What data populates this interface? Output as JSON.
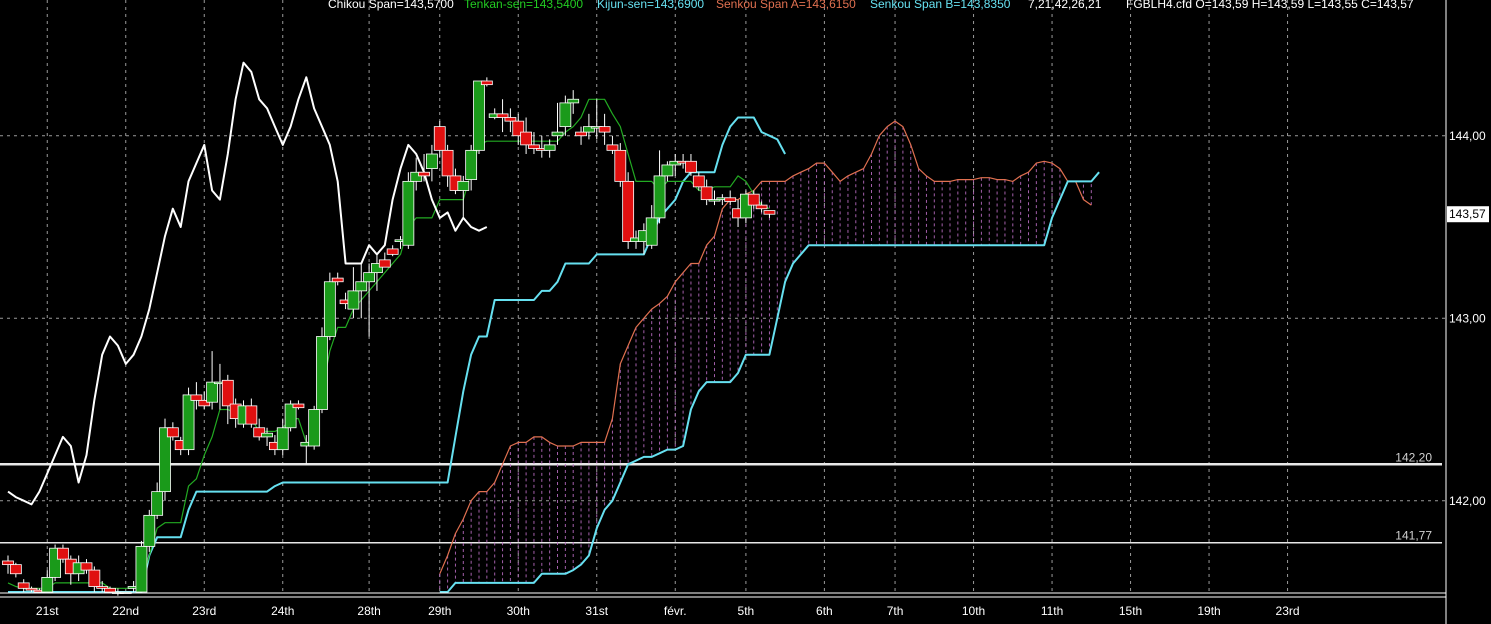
{
  "header": {
    "chikou": "Chikou Span=143,5700",
    "tenkan": "Tenkan-sen=143,5400",
    "kijun": "Kijun-sen=143,6900",
    "senkou_a": "Senkou Span A=143,6150",
    "senkou_b": "Senkou Span B=143,8350",
    "params": "7,21,42,26,21",
    "ohlc": "FGBLH4.cfd O=143,59 H=143,59 L=143,55 C=143,57"
  },
  "colors": {
    "background": "#000000",
    "bull": "#1a9a1a",
    "bear": "#e01010",
    "chikou": "#ffffff",
    "tenkan": "#22aa22",
    "kijun": "#66e0f0",
    "senkou_a": "#e07050",
    "senkou_b": "#66e0f0",
    "cloud_fill": "#c070c8",
    "grid": "#9a9a9a",
    "hline": "#e8e8e8"
  },
  "chart_data": {
    "type": "candlestick",
    "ylim": [
      141.5,
      144.7
    ],
    "y_ticks": [
      "144,00",
      "143,00",
      "142,00"
    ],
    "y_tick_values": [
      144.0,
      143.0,
      142.0
    ],
    "x_labels": [
      "21st",
      "22nd",
      "23rd",
      "24th",
      "28th",
      "29th",
      "30th",
      "31st",
      "févr.",
      "5th",
      "6th",
      "7th",
      "10th",
      "11th",
      "15th",
      "19th",
      "23rd"
    ],
    "x_label_index": [
      5,
      15,
      25,
      35,
      46,
      55,
      65,
      75,
      85,
      94,
      104,
      113,
      123,
      133,
      143,
      153,
      163
    ],
    "h_lines": [
      {
        "label": "142,20",
        "value": 142.2
      },
      {
        "label": "141,77",
        "value": 141.77
      }
    ],
    "last_price": "143,57",
    "last_price_value": 143.57,
    "candles": [
      [
        141.67,
        141.7,
        141.6,
        141.65
      ],
      [
        141.65,
        141.66,
        141.58,
        141.6
      ],
      [
        141.55,
        141.57,
        141.5,
        141.52
      ],
      [
        141.52,
        141.53,
        141.5,
        141.51
      ],
      [
        141.51,
        141.52,
        141.5,
        141.5
      ],
      [
        141.5,
        141.62,
        141.5,
        141.58
      ],
      [
        141.58,
        141.76,
        141.56,
        141.74
      ],
      [
        141.74,
        141.76,
        141.66,
        141.68
      ],
      [
        141.68,
        141.7,
        141.54,
        141.6
      ],
      [
        141.6,
        141.7,
        141.56,
        141.66
      ],
      [
        141.66,
        141.68,
        141.6,
        141.62
      ],
      [
        141.62,
        141.64,
        141.5,
        141.53
      ],
      [
        141.53,
        141.56,
        141.5,
        141.52
      ],
      [
        141.52,
        141.53,
        141.5,
        141.5
      ],
      [
        141.5,
        141.52,
        141.48,
        141.5
      ],
      [
        141.5,
        141.5,
        141.5,
        141.5
      ],
      [
        141.52,
        141.56,
        141.5,
        141.53
      ],
      [
        141.5,
        141.78,
        141.5,
        141.75
      ],
      [
        141.75,
        141.95,
        141.72,
        141.92
      ],
      [
        141.92,
        142.1,
        141.9,
        142.05
      ],
      [
        142.05,
        142.45,
        142.0,
        142.4
      ],
      [
        142.4,
        142.43,
        142.33,
        142.35
      ],
      [
        142.33,
        142.35,
        142.25,
        142.28
      ],
      [
        142.28,
        142.62,
        142.25,
        142.58
      ],
      [
        142.58,
        142.65,
        142.5,
        142.55
      ],
      [
        142.55,
        142.6,
        142.5,
        142.52
      ],
      [
        142.54,
        142.82,
        142.5,
        142.65
      ],
      [
        142.65,
        142.75,
        142.5,
        142.65
      ],
      [
        142.66,
        142.69,
        142.42,
        142.52
      ],
      [
        142.53,
        142.56,
        142.4,
        142.45
      ],
      [
        142.42,
        142.55,
        142.4,
        142.52
      ],
      [
        142.52,
        142.56,
        142.4,
        142.42
      ],
      [
        142.4,
        142.45,
        142.33,
        142.35
      ],
      [
        142.35,
        142.4,
        142.3,
        142.37
      ],
      [
        142.32,
        142.36,
        142.25,
        142.28
      ],
      [
        142.28,
        142.45,
        142.25,
        142.4
      ],
      [
        142.4,
        142.55,
        142.38,
        142.53
      ],
      [
        142.53,
        142.55,
        142.5,
        142.51
      ],
      [
        142.3,
        142.36,
        142.2,
        142.32
      ],
      [
        142.3,
        142.52,
        142.28,
        142.5
      ],
      [
        142.5,
        142.95,
        142.48,
        142.9
      ],
      [
        142.9,
        143.25,
        142.88,
        143.2
      ],
      [
        143.22,
        143.25,
        143.18,
        143.2
      ],
      [
        143.1,
        143.14,
        143.05,
        143.08
      ],
      [
        143.05,
        143.28,
        143.0,
        143.15
      ],
      [
        143.15,
        143.3,
        143.0,
        143.2
      ],
      [
        143.2,
        143.3,
        142.9,
        143.25
      ],
      [
        143.25,
        143.35,
        143.15,
        143.3
      ],
      [
        143.32,
        143.36,
        143.28,
        143.28
      ],
      [
        143.38,
        143.4,
        143.34,
        143.35
      ],
      [
        143.42,
        143.45,
        143.38,
        143.43
      ],
      [
        143.4,
        143.8,
        143.38,
        143.75
      ],
      [
        143.75,
        143.88,
        143.7,
        143.8
      ],
      [
        143.8,
        143.9,
        143.75,
        143.78
      ],
      [
        143.82,
        143.95,
        143.75,
        143.9
      ],
      [
        144.05,
        144.08,
        143.88,
        143.92
      ],
      [
        143.92,
        143.95,
        143.72,
        143.78
      ],
      [
        143.78,
        143.82,
        143.68,
        143.7
      ],
      [
        143.7,
        143.78,
        143.55,
        143.75
      ],
      [
        143.76,
        143.95,
        143.7,
        143.92
      ],
      [
        143.92,
        144.3,
        143.9,
        144.3
      ],
      [
        144.3,
        144.32,
        144.27,
        144.28
      ],
      [
        144.1,
        144.15,
        144.09,
        144.12
      ],
      [
        144.12,
        144.2,
        144.02,
        144.1
      ],
      [
        144.1,
        144.15,
        144.02,
        144.08
      ],
      [
        144.08,
        144.12,
        143.95,
        144.0
      ],
      [
        144.02,
        144.1,
        143.9,
        143.95
      ],
      [
        143.95,
        144.02,
        143.9,
        143.93
      ],
      [
        143.93,
        144.0,
        143.88,
        143.92
      ],
      [
        143.92,
        143.98,
        143.88,
        143.95
      ],
      [
        144.0,
        144.18,
        143.95,
        144.02
      ],
      [
        144.05,
        144.22,
        144.0,
        144.18
      ],
      [
        144.18,
        144.25,
        144.12,
        144.2
      ],
      [
        144.02,
        144.05,
        143.95,
        144.0
      ],
      [
        144.02,
        144.12,
        143.98,
        144.05
      ],
      [
        144.05,
        144.2,
        143.98,
        144.05
      ],
      [
        144.05,
        144.12,
        143.95,
        144.02
      ],
      [
        143.95,
        144.0,
        143.9,
        143.92
      ],
      [
        143.92,
        143.96,
        143.72,
        143.75
      ],
      [
        143.75,
        143.8,
        143.38,
        143.42
      ],
      [
        143.42,
        143.48,
        143.38,
        143.44
      ],
      [
        143.42,
        143.52,
        143.35,
        143.48
      ],
      [
        143.4,
        143.62,
        143.38,
        143.55
      ],
      [
        143.55,
        143.92,
        143.52,
        143.78
      ],
      [
        143.78,
        143.86,
        143.75,
        143.84
      ],
      [
        143.84,
        143.9,
        143.78,
        143.86
      ],
      [
        143.86,
        143.9,
        143.82,
        143.85
      ],
      [
        143.86,
        143.9,
        143.78,
        143.8
      ],
      [
        143.78,
        143.8,
        143.7,
        143.72
      ],
      [
        143.72,
        143.76,
        143.62,
        143.65
      ],
      [
        143.65,
        143.7,
        143.62,
        143.65
      ],
      [
        143.65,
        143.68,
        143.62,
        143.66
      ],
      [
        143.66,
        143.7,
        143.62,
        143.64
      ],
      [
        143.6,
        143.65,
        143.5,
        143.55
      ],
      [
        143.55,
        143.7,
        143.52,
        143.68
      ],
      [
        143.68,
        143.7,
        143.6,
        143.62
      ],
      [
        143.62,
        143.64,
        143.58,
        143.6
      ],
      [
        143.59,
        143.59,
        143.55,
        143.57
      ]
    ],
    "chikou": [
      142.05,
      142.02,
      142.0,
      141.98,
      142.05,
      142.15,
      142.25,
      142.35,
      142.3,
      142.1,
      142.25,
      142.55,
      142.8,
      142.9,
      142.85,
      142.75,
      142.8,
      142.9,
      143.05,
      143.25,
      143.45,
      143.6,
      143.5,
      143.75,
      143.85,
      143.95,
      143.7,
      143.65,
      143.9,
      144.2,
      144.4,
      144.35,
      144.2,
      144.15,
      144.05,
      143.95,
      144.05,
      144.2,
      144.32,
      144.15,
      144.05,
      143.95,
      143.75,
      143.3,
      143.3,
      143.3,
      143.4,
      143.35,
      143.4,
      143.65,
      143.82,
      143.95,
      143.9,
      143.8,
      143.65,
      143.55,
      143.58,
      143.48,
      143.55,
      143.5,
      143.48,
      143.5
    ],
    "chikou_start": 0,
    "tenkan": [
      141.55,
      141.53,
      141.52,
      141.52,
      141.52,
      141.52,
      141.55,
      141.55,
      141.55,
      141.55,
      141.55,
      141.55,
      141.55,
      141.52,
      141.52,
      141.52,
      141.52,
      141.55,
      141.7,
      141.85,
      141.88,
      141.88,
      141.88,
      142.08,
      142.12,
      142.25,
      142.35,
      142.5,
      142.5,
      142.48,
      142.5,
      142.45,
      142.38,
      142.38,
      142.38,
      142.4,
      142.45,
      142.45,
      142.32,
      142.32,
      142.6,
      142.82,
      142.95,
      142.95,
      143.05,
      143.1,
      143.15,
      143.2,
      143.25,
      143.3,
      143.35,
      143.5,
      143.55,
      143.55,
      143.55,
      143.65,
      143.65,
      143.65,
      143.65,
      143.8,
      143.95,
      143.97,
      143.97,
      143.97,
      143.97,
      143.97,
      143.97,
      143.97,
      143.97,
      143.97,
      143.97,
      144.02,
      144.05,
      144.1,
      144.2,
      144.2,
      144.2,
      144.12,
      144.05,
      143.9,
      143.75,
      143.75,
      143.75,
      143.7,
      143.75,
      143.75,
      143.75,
      143.75,
      143.7,
      143.7,
      143.72,
      143.72,
      143.72,
      143.78,
      143.75,
      143.68,
      143.62,
      143.6
    ],
    "kijun": [
      141.5,
      141.5,
      141.5,
      141.5,
      141.5,
      141.5,
      141.5,
      141.5,
      141.5,
      141.5,
      141.5,
      141.5,
      141.5,
      141.5,
      141.5,
      141.5,
      141.5,
      141.5,
      141.7,
      141.8,
      141.8,
      141.8,
      141.8,
      141.95,
      142.05,
      142.05,
      142.05,
      142.05,
      142.05,
      142.05,
      142.05,
      142.05,
      142.05,
      142.05,
      142.08,
      142.1,
      142.1,
      142.1,
      142.1,
      142.1,
      142.1,
      142.1,
      142.1,
      142.1,
      142.1,
      142.1,
      142.1,
      142.1,
      142.1,
      142.1,
      142.1,
      142.1,
      142.1,
      142.1,
      142.1,
      142.1,
      142.1,
      142.35,
      142.6,
      142.8,
      142.9,
      142.9,
      143.1,
      143.1,
      143.1,
      143.1,
      143.1,
      143.1,
      143.15,
      143.15,
      143.2,
      143.3,
      143.3,
      143.3,
      143.3,
      143.35,
      143.35,
      143.35,
      143.35,
      143.35,
      143.35,
      143.35,
      143.45,
      143.55,
      143.6,
      143.65,
      143.75,
      143.8,
      143.8,
      143.8,
      143.8,
      143.95,
      144.05,
      144.1,
      144.1,
      144.1,
      144.02,
      144.0,
      143.98,
      143.9
    ],
    "kijun_start": 0,
    "senkou_a": [
      141.6,
      141.7,
      141.82,
      141.9,
      142.0,
      142.05,
      142.05,
      142.1,
      142.2,
      142.3,
      142.32,
      142.32,
      142.35,
      142.35,
      142.32,
      142.3,
      142.3,
      142.3,
      142.32,
      142.32,
      142.32,
      142.32,
      142.45,
      142.75,
      142.85,
      142.95,
      143.0,
      143.05,
      143.08,
      143.12,
      143.2,
      143.25,
      143.3,
      143.3,
      143.4,
      143.45,
      143.6,
      143.65,
      143.65,
      143.68,
      143.7,
      143.75,
      143.75,
      143.75,
      143.75,
      143.78,
      143.8,
      143.82,
      143.85,
      143.85,
      143.8,
      143.75,
      143.78,
      143.8,
      143.82,
      143.9,
      144.0,
      144.05,
      144.08,
      144.05,
      143.95,
      143.82,
      143.78,
      143.75,
      143.75,
      143.75,
      143.76,
      143.76,
      143.76,
      143.77,
      143.77,
      143.76,
      143.76,
      143.75,
      143.78,
      143.8,
      143.85,
      143.86,
      143.85,
      143.82,
      143.75,
      143.75,
      143.65,
      143.62
    ],
    "senkou_b": [
      141.5,
      141.5,
      141.55,
      141.55,
      141.55,
      141.55,
      141.55,
      141.55,
      141.55,
      141.55,
      141.55,
      141.55,
      141.55,
      141.6,
      141.6,
      141.6,
      141.6,
      141.62,
      141.65,
      141.7,
      141.85,
      141.95,
      142.0,
      142.1,
      142.2,
      142.22,
      142.24,
      142.24,
      142.26,
      142.28,
      142.28,
      142.3,
      142.5,
      142.6,
      142.65,
      142.65,
      142.65,
      142.65,
      142.7,
      142.8,
      142.8,
      142.8,
      142.8,
      143.0,
      143.2,
      143.3,
      143.35,
      143.4,
      143.4,
      143.4,
      143.4,
      143.4,
      143.4,
      143.4,
      143.4,
      143.4,
      143.4,
      143.4,
      143.4,
      143.4,
      143.4,
      143.4,
      143.4,
      143.4,
      143.4,
      143.4,
      143.4,
      143.4,
      143.4,
      143.4,
      143.4,
      143.4,
      143.4,
      143.4,
      143.4,
      143.4,
      143.4,
      143.4,
      143.55,
      143.65,
      143.75,
      143.75,
      143.75,
      143.75,
      143.8
    ],
    "senkou_start": 55
  }
}
